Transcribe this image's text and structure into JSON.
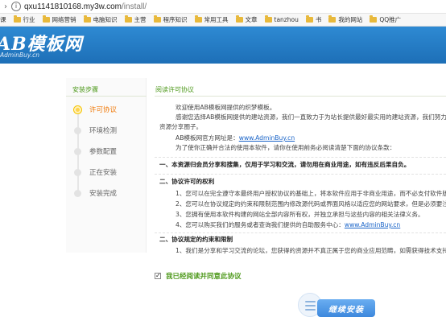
{
  "browser": {
    "url_prefix": "qxu1141810168.my3w.com",
    "url_path": "/install/",
    "bookmarks": [
      "课",
      "行业",
      "网络营销",
      "电脑知识",
      "主营",
      "程序知识",
      "常用工具",
      "文章",
      "tanzhou",
      "书",
      "我的网站",
      "QQ推广"
    ]
  },
  "header": {
    "logo": "AB模板网",
    "logo_sub": "AdminBuy.cn",
    "brand_color": "#1f74bd"
  },
  "sidebar": {
    "title": "安装步骤",
    "steps": [
      {
        "label": "许可协议",
        "active": true
      },
      {
        "label": "环境检测",
        "active": false
      },
      {
        "label": "参数配置",
        "active": false
      },
      {
        "label": "正在安装",
        "active": false
      },
      {
        "label": "安装完成",
        "active": false
      }
    ]
  },
  "main": {
    "title": "阅读许可协议",
    "agreement": {
      "p1": "欢迎使用AB模板网提供的织梦模板。",
      "p2": "感谢您选择AB模板网提供的建站资源，我们一直致力于为站长提供最好最实用的建站资源，我们努力成",
      "p3": "资源分享圈子。",
      "p4_prefix": "AB模板网官方网址是：",
      "p4_link": "www.AdminBuy.cn",
      "p5": "为了使你正确并合法的使用本软件，请你在使用前务必阅读清楚下面的协议条款：",
      "h1": "一、本资源归会员分享和搜集，仅用于学习和交流，请勿用在商业用途，如有违反后果自负。",
      "h2": "二、协议许可的权利",
      "l1": "1、您可以在完全遵守本最终用户授权协议的基础上，将本软件应用于非商业用途，而不必支付软件版权",
      "l2": "2、您可以在协议规定的约束和限制范围内修改源代码或界面风格以适应您的网站要求，但是必须要注明",
      "l3": "3、您拥有使用本软件构建的网站全部内容所有权，并独立承担与这些内容的相关法律义务。",
      "l4_prefix": "4、您可以购买我们的服务或者查询我们提供的自助服务中心：",
      "l4_link": "www.AdminBuy.cn",
      "h3": "二、协议规定的约束和限制",
      "l5": "1、我们是分享和学习交流的论坛，您获得的资源并不真正属于您的商业应用范畴，如需获得技术支持，"
    },
    "agree_label": "我已经阅读并同意此协议",
    "agree_checked": true,
    "continue_label": "继续安装"
  }
}
